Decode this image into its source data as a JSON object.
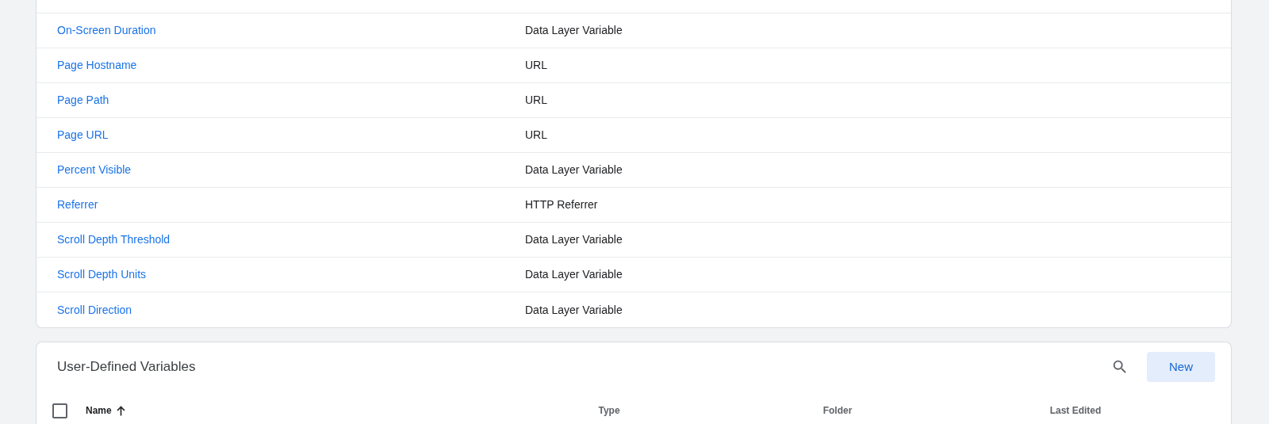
{
  "builtin_variables": {
    "rows": [
      {
        "name": "On-Screen Duration",
        "type": "Data Layer Variable"
      },
      {
        "name": "Page Hostname",
        "type": "URL"
      },
      {
        "name": "Page Path",
        "type": "URL"
      },
      {
        "name": "Page URL",
        "type": "URL"
      },
      {
        "name": "Percent Visible",
        "type": "Data Layer Variable"
      },
      {
        "name": "Referrer",
        "type": "HTTP Referrer"
      },
      {
        "name": "Scroll Depth Threshold",
        "type": "Data Layer Variable"
      },
      {
        "name": "Scroll Depth Units",
        "type": "Data Layer Variable"
      },
      {
        "name": "Scroll Direction",
        "type": "Data Layer Variable"
      }
    ]
  },
  "user_defined_variables": {
    "title": "User-Defined Variables",
    "new_button": "New",
    "select_all": {
      "checked": false
    },
    "columns": [
      {
        "label": "Name",
        "sorted": true
      },
      {
        "label": "Type",
        "sorted": false
      },
      {
        "label": "Folder",
        "sorted": false
      },
      {
        "label": "Last Edited",
        "sorted": false
      }
    ]
  }
}
